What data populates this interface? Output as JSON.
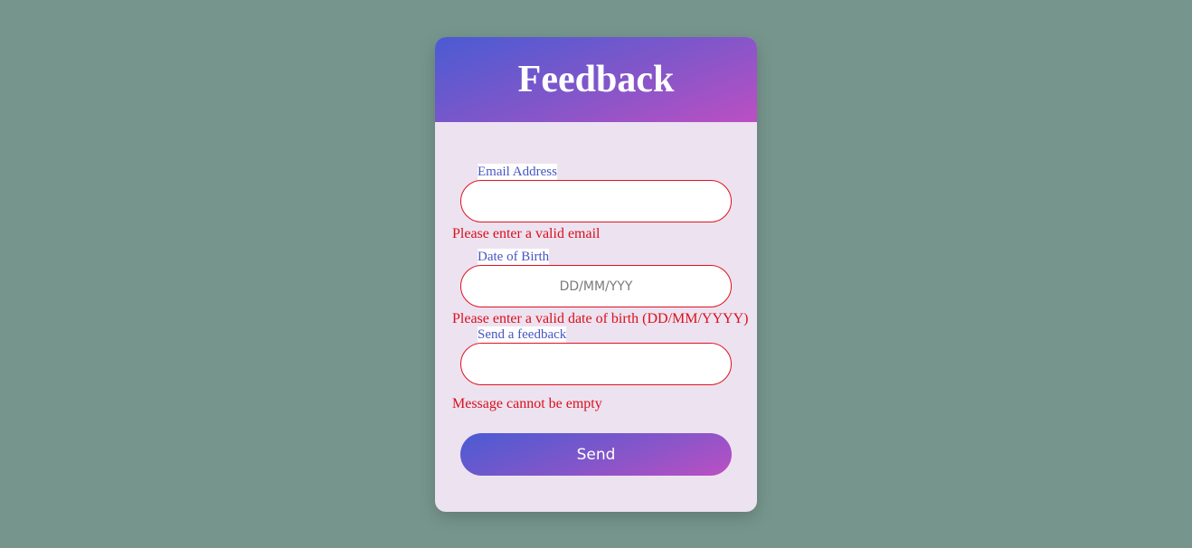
{
  "form": {
    "title": "Feedback",
    "fields": [
      {
        "label": "Email Address",
        "value": "",
        "placeholder": "",
        "error": "Please enter a valid email"
      },
      {
        "label": "Date of Birth",
        "value": "",
        "placeholder": "DD/MM/YYY",
        "error": "Please enter a valid date of birth (DD/MM/YYYY)"
      },
      {
        "label": "Send a feedback",
        "value": "",
        "placeholder": "",
        "error": "Message cannot be empty"
      }
    ],
    "submit_label": "Send"
  },
  "colors": {
    "page_background": "#76968d",
    "card_background": "#ede2f0",
    "gradient_start": "#4a5bd3",
    "gradient_end": "#bb4fc3",
    "error": "#d8101c",
    "label": "#4656c2"
  }
}
